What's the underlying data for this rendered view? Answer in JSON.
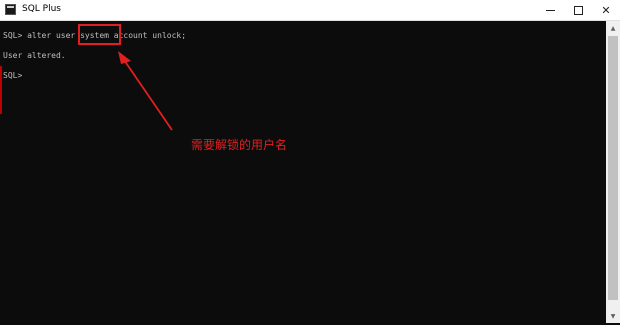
{
  "window": {
    "title": "SQL Plus",
    "controls": {
      "minimize_icon": "minimize-icon",
      "maximize_icon": "maximize-icon",
      "close_glyph": "✕"
    }
  },
  "console": {
    "lines": [
      "SQL> alter user system account unlock;",
      "User altered.",
      "SQL>"
    ]
  },
  "annotation": {
    "text": "需要解锁的用户名",
    "color": "#e02020"
  },
  "scrollbar": {
    "up": "▲",
    "down": "▼"
  }
}
